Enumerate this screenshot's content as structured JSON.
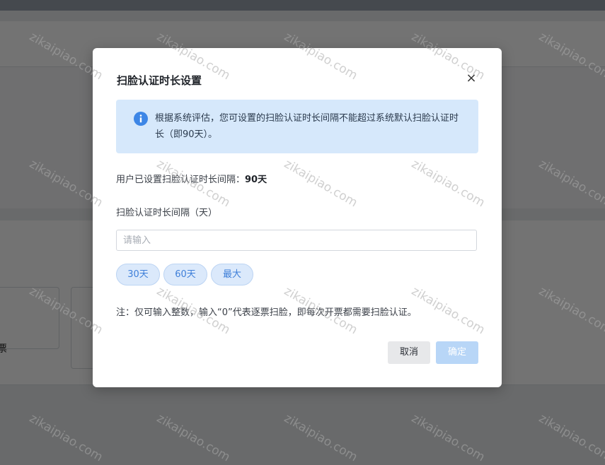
{
  "background": {
    "card_text": "票"
  },
  "modal": {
    "title": "扫脸认证时长设置",
    "close_label": "×",
    "info_text": "根据系统评估，您可设置的扫脸认证时长间隔不能超过系统默认扫脸认证时长（即90天）。",
    "current_label": "用户已设置扫脸认证时长间隔：",
    "current_value": "90天",
    "field_label": "扫脸认证时长间隔（天）",
    "input_placeholder": "请输入",
    "input_value": "",
    "chips": [
      "30天",
      "60天",
      "最大"
    ],
    "note": "注：仅可输入整数，输入“0”代表逐票扫脸，即每次开票都需要扫脸认证。",
    "cancel_label": "取消",
    "confirm_label": "确定"
  },
  "watermark": "zikaipiao.com",
  "colors": {
    "accent": "#3e7fd9",
    "info_bg": "#d6e8fb",
    "info_icon": "#3d86e6",
    "confirm_disabled": "#b8d6f7"
  }
}
